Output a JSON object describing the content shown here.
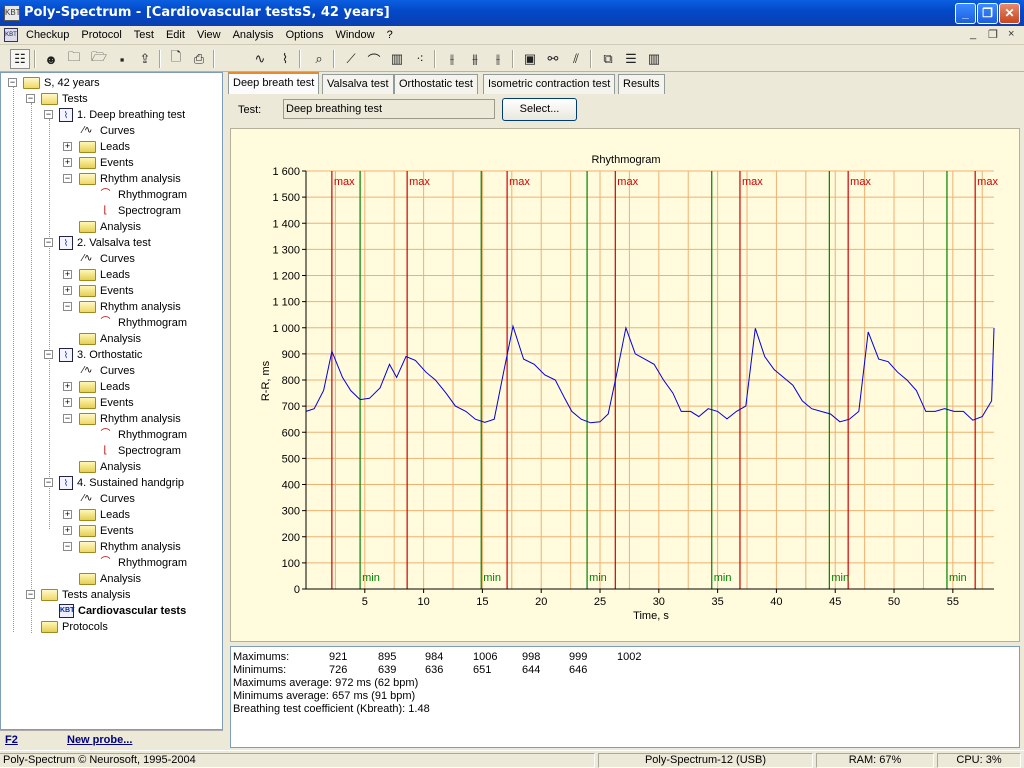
{
  "window": {
    "title": "Poly-Spectrum - [Cardiovascular testsS, 42 years]",
    "app_icon": "KBT",
    "minimize_icon": "minimize-icon",
    "maximize_icon": "restore-icon",
    "close_icon": "close-icon"
  },
  "menu": {
    "mdi_icon": "KBT",
    "items": [
      "Checkup",
      "Protocol",
      "Test",
      "Edit",
      "View",
      "Analysis",
      "Options",
      "Window",
      "?"
    ]
  },
  "toolbar": {
    "icons": [
      "tree-view-icon",
      "person-icon",
      "open-folder-icon",
      "folder-icon",
      "save-icon",
      "export-icon",
      "print-preview-icon",
      "print-icon",
      "curve-icon",
      "rhythm-icon",
      "zoom-icon",
      "line-icon",
      "line2-icon",
      "bars-icon",
      "scatter-icon",
      "markers-icon",
      "markers2-icon",
      "markers3-icon",
      "kbt-icon",
      "graph-icon",
      "chart-icon",
      "cascade-icon",
      "tile-horizontal-icon",
      "tile-vertical-icon"
    ]
  },
  "tree": {
    "root": "S, 42 years",
    "tests": "Tests",
    "test1": "1. Deep breathing test",
    "test2": "2. Valsalva test",
    "test3": "3. Orthostatic",
    "test4": "4. Sustained handgrip",
    "curves": "Curves",
    "leads": "Leads",
    "events": "Events",
    "rhythm_analysis": "Rhythm analysis",
    "rhythmogram": "Rhythmogram",
    "spectrogram": "Spectrogram",
    "analysis": "Analysis",
    "tests_analysis": "Tests analysis",
    "cardio": "Cardiovascular tests",
    "protocols": "Protocols"
  },
  "left_bottom": {
    "f2": "F2",
    "new_probe": "New probe..."
  },
  "tabs": [
    "Deep breath test",
    "Valsalva test",
    "Orthostatic test",
    "Isometric contraction test",
    "Results"
  ],
  "test_row": {
    "label": "Test:",
    "value": "Deep breathing test",
    "select_button": "Select..."
  },
  "chart_data": {
    "type": "line",
    "title": "Rhythmogram",
    "xlabel": "Time, s",
    "ylabel": "R-R, ms",
    "xlim": [
      0,
      58.5
    ],
    "ylim": [
      0,
      1600
    ],
    "xticks": [
      5,
      10,
      15,
      20,
      25,
      30,
      35,
      40,
      45,
      50,
      55
    ],
    "yticks": [
      0,
      100,
      200,
      300,
      400,
      500,
      600,
      700,
      800,
      900,
      1000,
      1100,
      1200,
      1300,
      1400,
      1500,
      1600
    ],
    "ytick_labels": [
      "0",
      "100",
      "200",
      "300",
      "400",
      "500",
      "600",
      "700",
      "800",
      "900",
      "1 000",
      "1 100",
      "1 200",
      "1 300",
      "1 400",
      "1 500",
      "1 600"
    ],
    "grid": true,
    "x": [
      0,
      0.7,
      1.5,
      2.2,
      3.1,
      3.8,
      4.6,
      5.4,
      6.3,
      7.1,
      7.7,
      8.5,
      9.3,
      10.2,
      11.0,
      11.9,
      12.7,
      13.6,
      14.4,
      15.2,
      16.0,
      16.8,
      17.6,
      18.5,
      19.4,
      20.3,
      21.2,
      22.0,
      22.6,
      23.4,
      24.2,
      25.0,
      25.7,
      26.4,
      27.2,
      28.0,
      28.8,
      29.6,
      30.4,
      31.2,
      31.9,
      32.7,
      33.4,
      34.2,
      35.0,
      35.8,
      36.6,
      37.4,
      38.2,
      39.0,
      39.8,
      40.6,
      41.4,
      42.2,
      43.0,
      43.8,
      44.6,
      45.4,
      46.2,
      47.0,
      47.8,
      48.7,
      49.5,
      50.3,
      51.1,
      51.9,
      52.7,
      53.5,
      54.3,
      55.1,
      55.9,
      56.7,
      57.5,
      58.3,
      59.0
    ],
    "y": [
      680,
      690,
      760,
      910,
      810,
      760,
      725,
      730,
      770,
      860,
      810,
      890,
      875,
      830,
      800,
      750,
      700,
      680,
      650,
      638,
      650,
      830,
      1006,
      880,
      860,
      820,
      800,
      730,
      680,
      650,
      636,
      640,
      670,
      820,
      1000,
      900,
      880,
      860,
      800,
      750,
      680,
      680,
      660,
      690,
      680,
      651,
      680,
      700,
      998,
      890,
      840,
      810,
      780,
      720,
      690,
      680,
      670,
      640,
      650,
      680,
      984,
      880,
      870,
      830,
      800,
      760,
      680,
      680,
      690,
      680,
      680,
      646,
      660,
      720,
      999,
      880,
      870,
      850
    ],
    "max_lines_x": [
      2.2,
      8.6,
      17.1,
      26.3,
      36.9,
      46.1,
      56.9
    ],
    "min_lines_x": [
      4.6,
      14.9,
      23.9,
      34.5,
      44.5,
      54.5
    ],
    "max_label": "max",
    "min_label": "min"
  },
  "stats": {
    "max_label": "Maximums:",
    "min_label": "Minimums:",
    "maximums": [
      "921",
      "895",
      "984",
      "1006",
      "998",
      "999",
      "1002"
    ],
    "minimums": [
      "726",
      "639",
      "636",
      "651",
      "644",
      "646"
    ],
    "max_avg": "Maximums average: 972 ms (62 bpm)",
    "min_avg": "Minimums average: 657 ms (91 bpm)",
    "kbreath": "Breathing test coefficient (Kbreath): 1.48"
  },
  "status": {
    "copyright": "Poly-Spectrum © Neurosoft, 1995-2004",
    "device": "Poly-Spectrum-12 (USB)",
    "ram": "RAM: 67%",
    "cpu": "CPU: 3%"
  }
}
